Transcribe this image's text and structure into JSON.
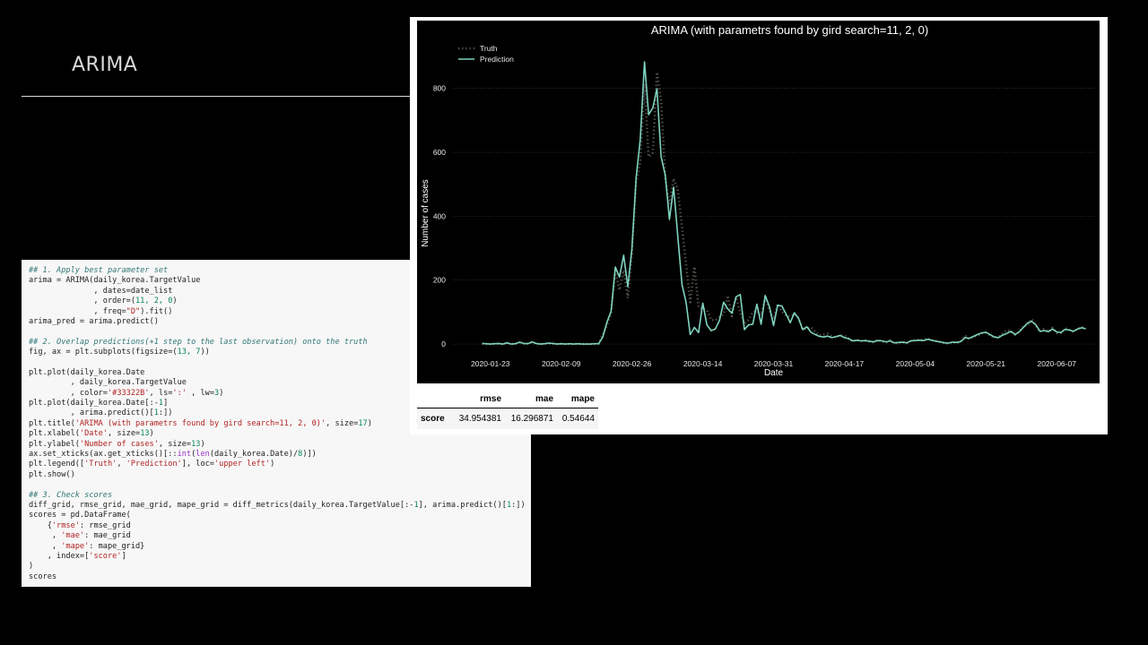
{
  "slide": {
    "title": "ARIMA"
  },
  "code": {
    "lines": [
      [
        [
          "c",
          "## 1. Apply best parameter set"
        ]
      ],
      [
        [
          "t",
          "arima = ARIMA(daily_korea.TargetValue"
        ]
      ],
      [
        [
          "t",
          "              , dates=date_list"
        ]
      ],
      [
        [
          "t",
          "              , order=("
        ],
        [
          "n",
          "11, 2, 0"
        ],
        [
          "t",
          ")"
        ]
      ],
      [
        [
          "t",
          "              , freq="
        ],
        [
          "s",
          "\"D\""
        ],
        [
          "t",
          ").fit()"
        ]
      ],
      [
        [
          "t",
          "arima_pred = arima.predict()"
        ]
      ],
      [
        [
          "t",
          ""
        ]
      ],
      [
        [
          "c",
          "## 2. Overlap predictions(+1 step to the last observation) onto the truth"
        ]
      ],
      [
        [
          "t",
          "fig, ax = plt.subplots(figsize=("
        ],
        [
          "n",
          "13, 7"
        ],
        [
          "t",
          "))"
        ]
      ],
      [
        [
          "t",
          ""
        ]
      ],
      [
        [
          "t",
          "plt.plot(daily_korea.Date"
        ]
      ],
      [
        [
          "t",
          "         , daily_korea.TargetValue"
        ]
      ],
      [
        [
          "t",
          "         , color="
        ],
        [
          "s",
          "'#33322B'"
        ],
        [
          "t",
          ", ls="
        ],
        [
          "s",
          "':'"
        ],
        [
          "t",
          " , lw="
        ],
        [
          "n",
          "3"
        ],
        [
          "t",
          ")"
        ]
      ],
      [
        [
          "t",
          "plt.plot(daily_korea.Date[:-"
        ],
        [
          "n",
          "1"
        ],
        [
          "t",
          "]"
        ]
      ],
      [
        [
          "t",
          "         , arima.predict()["
        ],
        [
          "n",
          "1"
        ],
        [
          "t",
          ":])"
        ]
      ],
      [
        [
          "t",
          "plt.title("
        ],
        [
          "s",
          "'ARIMA (with parametrs found by gird search=11, 2, 0)'"
        ],
        [
          "t",
          ", size="
        ],
        [
          "n",
          "17"
        ],
        [
          "t",
          ")"
        ]
      ],
      [
        [
          "t",
          "plt.xlabel("
        ],
        [
          "s",
          "'Date'"
        ],
        [
          "t",
          ", size="
        ],
        [
          "n",
          "13"
        ],
        [
          "t",
          ")"
        ]
      ],
      [
        [
          "t",
          "plt.ylabel("
        ],
        [
          "s",
          "'Number of cases'"
        ],
        [
          "t",
          ", size="
        ],
        [
          "n",
          "13"
        ],
        [
          "t",
          ")"
        ]
      ],
      [
        [
          "t",
          "ax.set_xticks(ax.get_xticks()[::"
        ],
        [
          "o",
          "int"
        ],
        [
          "t",
          "("
        ],
        [
          "o",
          "len"
        ],
        [
          "t",
          "(daily_korea.Date)/"
        ],
        [
          "n",
          "8"
        ],
        [
          "t",
          ")])"
        ]
      ],
      [
        [
          "t",
          "plt.legend(["
        ],
        [
          "s",
          "'Truth'"
        ],
        [
          "t",
          ", "
        ],
        [
          "s",
          "'Prediction'"
        ],
        [
          "t",
          "], loc="
        ],
        [
          "s",
          "'upper left'"
        ],
        [
          "t",
          ")"
        ]
      ],
      [
        [
          "t",
          "plt.show()"
        ]
      ],
      [
        [
          "t",
          ""
        ]
      ],
      [
        [
          "c",
          "## 3. Check scores"
        ]
      ],
      [
        [
          "t",
          "diff_grid, rmse_grid, mae_grid, mape_grid = diff_metrics(daily_korea.TargetValue[:-"
        ],
        [
          "n",
          "1"
        ],
        [
          "t",
          "], arima.predict()["
        ],
        [
          "n",
          "1"
        ],
        [
          "t",
          ":])"
        ]
      ],
      [
        [
          "t",
          "scores = pd.DataFrame("
        ]
      ],
      [
        [
          "t",
          "    {"
        ],
        [
          "s",
          "'rmse'"
        ],
        [
          "t",
          ": rmse_grid"
        ]
      ],
      [
        [
          "t",
          "     , "
        ],
        [
          "s",
          "'mae'"
        ],
        [
          "t",
          ": mae_grid"
        ]
      ],
      [
        [
          "t",
          "     , "
        ],
        [
          "s",
          "'mape'"
        ],
        [
          "t",
          ": mape_grid}"
        ]
      ],
      [
        [
          "t",
          "    , index=["
        ],
        [
          "s",
          "'score'"
        ],
        [
          "t",
          "]"
        ]
      ],
      [
        [
          "t",
          ")"
        ]
      ],
      [
        [
          "t",
          "scores"
        ]
      ]
    ]
  },
  "chart_data": {
    "type": "line",
    "title": "ARIMA (with parametrs found by gird search=11, 2, 0)",
    "xlabel": "Date",
    "ylabel": "Number of cases",
    "x_start": "2020-01-21",
    "x_ticks": [
      "2020-01-23",
      "2020-02-09",
      "2020-02-26",
      "2020-03-14",
      "2020-03-31",
      "2020-04-17",
      "2020-05-04",
      "2020-05-21",
      "2020-06-07"
    ],
    "xlim": [
      "2020-01-14",
      "2020-06-16"
    ],
    "ylim": [
      -25,
      900
    ],
    "y_ticks": [
      0,
      200,
      400,
      600,
      800
    ],
    "grid": "horizontal",
    "legend": "upper-left",
    "colors": {
      "truth": "#5a5a52",
      "prediction": "#7fd3bf"
    },
    "series": [
      {
        "name": "Truth",
        "style": "dotted",
        "values": [
          1,
          0,
          0,
          1,
          1,
          0,
          3,
          0,
          1,
          4,
          1,
          2,
          5,
          1,
          0,
          1,
          2,
          1,
          0,
          1,
          0,
          0,
          0,
          1,
          0,
          0,
          0,
          0,
          1,
          31,
          58,
          100,
          229,
          169,
          231,
          144,
          284,
          505,
          571,
          813,
          586,
          599,
          851,
          760,
          516,
          438,
          518,
          483,
          367,
          248,
          131,
          242,
          114,
          110,
          107,
          76,
          74,
          84,
          93,
          152,
          87,
          147,
          98,
          64,
          76,
          100,
          104,
          91,
          146,
          105,
          78,
          125,
          101,
          89,
          86,
          94,
          81,
          47,
          47,
          53,
          39,
          27,
          30,
          32,
          25,
          22,
          27,
          27,
          18,
          8,
          13,
          9,
          11,
          8,
          6,
          14,
          9,
          4,
          12,
          2,
          4,
          6,
          3,
          10,
          13,
          14,
          13,
          18,
          12,
          10,
          6,
          3,
          2,
          6,
          4,
          9,
          27,
          16,
          23,
          26,
          34,
          35,
          27,
          20,
          23,
          33,
          44,
          39,
          29,
          40,
          58,
          58,
          79,
          57,
          38,
          49,
          39,
          51,
          34,
          35,
          50,
          45,
          38,
          49,
          53,
          56
        ]
      },
      {
        "name": "Prediction",
        "style": "solid",
        "values": [
          2,
          1,
          0,
          1,
          2,
          0,
          4,
          0,
          1,
          6,
          2,
          1,
          7,
          2,
          0,
          1,
          3,
          2,
          0,
          1,
          0,
          1,
          0,
          1,
          0,
          0,
          0,
          1,
          1,
          22,
          69,
          103,
          241,
          210,
          278,
          180,
          299,
          521,
          641,
          883,
          718,
          739,
          799,
          587,
          528,
          390,
          491,
          338,
          187,
          130,
          30,
          52,
          36,
          128,
          60,
          42,
          47,
          73,
          131,
          110,
          97,
          148,
          155,
          45,
          60,
          62,
          125,
          62,
          152,
          117,
          58,
          122,
          119,
          94,
          67,
          98,
          80,
          45,
          54,
          37,
          30,
          24,
          22,
          25,
          20,
          23,
          27,
          20,
          17,
          10,
          12,
          10,
          11,
          9,
          7,
          11,
          10,
          7,
          10,
          4,
          5,
          6,
          4,
          10,
          11,
          12,
          11,
          15,
          12,
          9,
          7,
          4,
          3,
          6,
          5,
          8,
          20,
          18,
          24,
          30,
          35,
          37,
          30,
          22,
          20,
          28,
          33,
          40,
          30,
          38,
          52,
          66,
          71,
          60,
          40,
          42,
          39,
          47,
          38,
          36,
          46,
          44,
          40,
          47,
          51,
          48
        ]
      }
    ]
  },
  "scores": {
    "columns": [
      "rmse",
      "mae",
      "mape"
    ],
    "rows": [
      {
        "index": "score",
        "values": [
          "34.954381",
          "16.296871",
          "0.54644"
        ]
      }
    ]
  }
}
